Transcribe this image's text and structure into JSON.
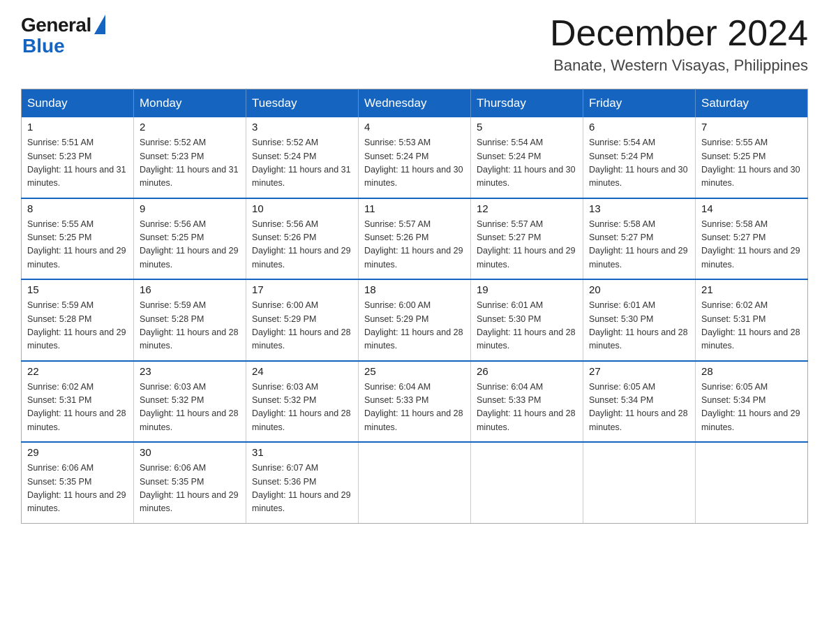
{
  "header": {
    "logo_general": "General",
    "logo_blue": "Blue",
    "month_year": "December 2024",
    "location": "Banate, Western Visayas, Philippines"
  },
  "columns": [
    "Sunday",
    "Monday",
    "Tuesday",
    "Wednesday",
    "Thursday",
    "Friday",
    "Saturday"
  ],
  "weeks": [
    [
      {
        "day": "1",
        "sunrise": "5:51 AM",
        "sunset": "5:23 PM",
        "daylight": "11 hours and 31 minutes."
      },
      {
        "day": "2",
        "sunrise": "5:52 AM",
        "sunset": "5:23 PM",
        "daylight": "11 hours and 31 minutes."
      },
      {
        "day": "3",
        "sunrise": "5:52 AM",
        "sunset": "5:24 PM",
        "daylight": "11 hours and 31 minutes."
      },
      {
        "day": "4",
        "sunrise": "5:53 AM",
        "sunset": "5:24 PM",
        "daylight": "11 hours and 30 minutes."
      },
      {
        "day": "5",
        "sunrise": "5:54 AM",
        "sunset": "5:24 PM",
        "daylight": "11 hours and 30 minutes."
      },
      {
        "day": "6",
        "sunrise": "5:54 AM",
        "sunset": "5:24 PM",
        "daylight": "11 hours and 30 minutes."
      },
      {
        "day": "7",
        "sunrise": "5:55 AM",
        "sunset": "5:25 PM",
        "daylight": "11 hours and 30 minutes."
      }
    ],
    [
      {
        "day": "8",
        "sunrise": "5:55 AM",
        "sunset": "5:25 PM",
        "daylight": "11 hours and 29 minutes."
      },
      {
        "day": "9",
        "sunrise": "5:56 AM",
        "sunset": "5:25 PM",
        "daylight": "11 hours and 29 minutes."
      },
      {
        "day": "10",
        "sunrise": "5:56 AM",
        "sunset": "5:26 PM",
        "daylight": "11 hours and 29 minutes."
      },
      {
        "day": "11",
        "sunrise": "5:57 AM",
        "sunset": "5:26 PM",
        "daylight": "11 hours and 29 minutes."
      },
      {
        "day": "12",
        "sunrise": "5:57 AM",
        "sunset": "5:27 PM",
        "daylight": "11 hours and 29 minutes."
      },
      {
        "day": "13",
        "sunrise": "5:58 AM",
        "sunset": "5:27 PM",
        "daylight": "11 hours and 29 minutes."
      },
      {
        "day": "14",
        "sunrise": "5:58 AM",
        "sunset": "5:27 PM",
        "daylight": "11 hours and 29 minutes."
      }
    ],
    [
      {
        "day": "15",
        "sunrise": "5:59 AM",
        "sunset": "5:28 PM",
        "daylight": "11 hours and 29 minutes."
      },
      {
        "day": "16",
        "sunrise": "5:59 AM",
        "sunset": "5:28 PM",
        "daylight": "11 hours and 28 minutes."
      },
      {
        "day": "17",
        "sunrise": "6:00 AM",
        "sunset": "5:29 PM",
        "daylight": "11 hours and 28 minutes."
      },
      {
        "day": "18",
        "sunrise": "6:00 AM",
        "sunset": "5:29 PM",
        "daylight": "11 hours and 28 minutes."
      },
      {
        "day": "19",
        "sunrise": "6:01 AM",
        "sunset": "5:30 PM",
        "daylight": "11 hours and 28 minutes."
      },
      {
        "day": "20",
        "sunrise": "6:01 AM",
        "sunset": "5:30 PM",
        "daylight": "11 hours and 28 minutes."
      },
      {
        "day": "21",
        "sunrise": "6:02 AM",
        "sunset": "5:31 PM",
        "daylight": "11 hours and 28 minutes."
      }
    ],
    [
      {
        "day": "22",
        "sunrise": "6:02 AM",
        "sunset": "5:31 PM",
        "daylight": "11 hours and 28 minutes."
      },
      {
        "day": "23",
        "sunrise": "6:03 AM",
        "sunset": "5:32 PM",
        "daylight": "11 hours and 28 minutes."
      },
      {
        "day": "24",
        "sunrise": "6:03 AM",
        "sunset": "5:32 PM",
        "daylight": "11 hours and 28 minutes."
      },
      {
        "day": "25",
        "sunrise": "6:04 AM",
        "sunset": "5:33 PM",
        "daylight": "11 hours and 28 minutes."
      },
      {
        "day": "26",
        "sunrise": "6:04 AM",
        "sunset": "5:33 PM",
        "daylight": "11 hours and 28 minutes."
      },
      {
        "day": "27",
        "sunrise": "6:05 AM",
        "sunset": "5:34 PM",
        "daylight": "11 hours and 28 minutes."
      },
      {
        "day": "28",
        "sunrise": "6:05 AM",
        "sunset": "5:34 PM",
        "daylight": "11 hours and 29 minutes."
      }
    ],
    [
      {
        "day": "29",
        "sunrise": "6:06 AM",
        "sunset": "5:35 PM",
        "daylight": "11 hours and 29 minutes."
      },
      {
        "day": "30",
        "sunrise": "6:06 AM",
        "sunset": "5:35 PM",
        "daylight": "11 hours and 29 minutes."
      },
      {
        "day": "31",
        "sunrise": "6:07 AM",
        "sunset": "5:36 PM",
        "daylight": "11 hours and 29 minutes."
      },
      null,
      null,
      null,
      null
    ]
  ]
}
